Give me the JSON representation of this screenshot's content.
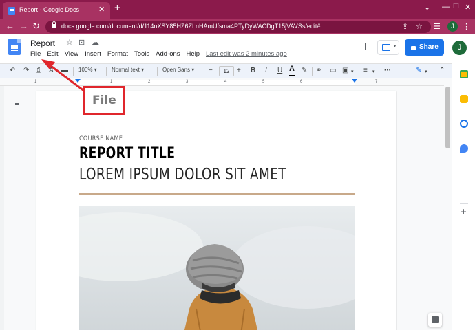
{
  "browser": {
    "tab_title": "Report - Google Docs",
    "url": "docs.google.com/document/d/114nXSY85HZ6ZLnHAmUfsma4PTyDyWACDgT15jVAVSs/edit#",
    "profile_initial": "J",
    "new_tab_symbol": "+",
    "close_symbol": "✕",
    "minimize_symbol": "—",
    "maximize_symbol": "☐",
    "window_close_symbol": "✕"
  },
  "docs": {
    "title": "Report",
    "menu": [
      "File",
      "Edit",
      "View",
      "Insert",
      "Format",
      "Tools",
      "Add-ons",
      "Help"
    ],
    "last_edit": "Last edit was 2 minutes ago",
    "share_label": "Share",
    "profile_initial": "J"
  },
  "toolbar": {
    "zoom": "100%",
    "style": "Normal text",
    "font": "Open Sans",
    "font_size": "12",
    "minus": "−",
    "plus": "+",
    "bold": "B",
    "italic": "I",
    "underline": "U",
    "text_color": "A",
    "more": "···"
  },
  "ruler": {
    "numbers": [
      "1",
      "1",
      "2",
      "3",
      "4",
      "5",
      "6",
      "7"
    ]
  },
  "document": {
    "course": "COURSE NAME",
    "report_title": "REPORT TITLE",
    "subtitle": "LOREM IPSUM DOLOR SIT AMET"
  },
  "annotation": {
    "callout_text": "File",
    "color": "#e0262c"
  },
  "colors": {
    "chrome_frame": "#8b1a4b",
    "chrome_toolbar": "#a83262",
    "share_button": "#1a73e8",
    "avatar": "#1e6b3a",
    "divider": "#c8a98a"
  }
}
